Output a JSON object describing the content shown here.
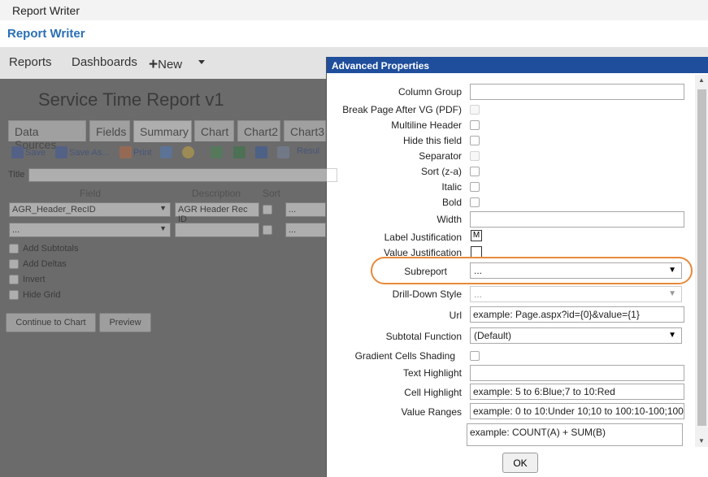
{
  "window_title": "Report Writer",
  "app_title": "Report Writer",
  "nav": {
    "reports": "Reports",
    "dashboards": "Dashboards",
    "new": "New"
  },
  "report_title": "Service Time Report v1",
  "tabs": [
    "Data Sources",
    "Fields",
    "Summary",
    "Chart",
    "Chart2",
    "Chart3"
  ],
  "active_tab": "Summary",
  "toolbar": {
    "save": "Save",
    "save_as": "Save As...",
    "print": "Print",
    "results": "Resul"
  },
  "title_label": "Title",
  "columns": {
    "field": "Field",
    "description": "Description",
    "sort": "Sort"
  },
  "rows": [
    {
      "field": "AGR_Header_RecID",
      "description": "AGR Header Rec ID",
      "extra": "..."
    },
    {
      "field": "...",
      "description": "",
      "extra": "..."
    }
  ],
  "options": [
    "Add Subtotals",
    "Add Deltas",
    "Invert",
    "Hide Grid"
  ],
  "buttons": {
    "continue": "Continue to Chart",
    "preview": "Preview"
  },
  "dialog": {
    "title": "Advanced Properties",
    "labels": {
      "column_group": "Column Group",
      "break_page": "Break Page After VG (PDF)",
      "multiline": "Multiline Header",
      "hide_field": "Hide this field",
      "separator": "Separator",
      "sort": "Sort (z-a)",
      "italic": "Italic",
      "bold": "Bold",
      "width": "Width",
      "label_just": "Label Justification",
      "value_just": "Value Justification",
      "subreport": "Subreport",
      "drilldown": "Drill-Down Style",
      "url": "Url",
      "subtotal_fn": "Subtotal Function",
      "gradient": "Gradient Cells Shading",
      "text_highlight": "Text Highlight",
      "cell_highlight": "Cell Highlight",
      "value_ranges": "Value Ranges"
    },
    "values": {
      "label_just": "M",
      "subreport": "...",
      "drilldown": "...",
      "url_placeholder": "example: Page.aspx?id={0}&value={1}",
      "subtotal_fn": "(Default)",
      "cell_highlight_placeholder": "example: 5 to 6:Blue;7 to 10:Red",
      "value_ranges_placeholder": "example: 0 to 10:Under 10;10 to 100:10-100;100",
      "expression_placeholder": "example: COUNT(A) + SUM(B)"
    },
    "ok": "OK"
  },
  "colors": {
    "brand": "#2a6fb4",
    "dialog_header": "#1e4e9c",
    "highlight": "#e8893a"
  }
}
